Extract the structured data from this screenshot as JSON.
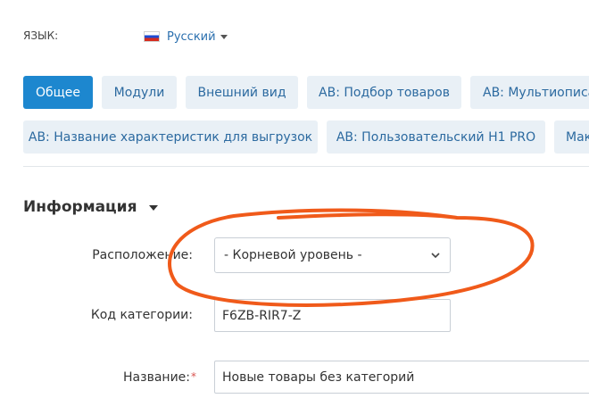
{
  "language": {
    "label": "ЯЗЫК:",
    "current": "Русский",
    "flag_icon": "russia-flag-icon"
  },
  "tabs": [
    {
      "label": "Общее",
      "active": true
    },
    {
      "label": "Модули",
      "active": false
    },
    {
      "label": "Внешний вид",
      "active": false
    },
    {
      "label": "АВ: Подбор товаров",
      "active": false
    },
    {
      "label": "АВ: Мультиописа",
      "active": false
    },
    {
      "label": "АВ: Название характеристик для выгрузок",
      "active": false
    },
    {
      "label": "АВ: Пользовательский H1 PRO",
      "active": false
    },
    {
      "label": "Мак",
      "active": false
    }
  ],
  "section": {
    "title": "Информация"
  },
  "fields": {
    "location": {
      "label": "Расположение:",
      "value": "- Корневой уровень -"
    },
    "category_code": {
      "label": "Код категории:",
      "value": "F6ZB-RIR7-Z"
    },
    "name": {
      "label": "Название:",
      "required_mark": "*",
      "value": "Новые товары без категорий"
    }
  },
  "colors": {
    "accent": "#1d87cf",
    "tab_bg": "#e9f0f6",
    "annotation": "#f05a1a"
  }
}
